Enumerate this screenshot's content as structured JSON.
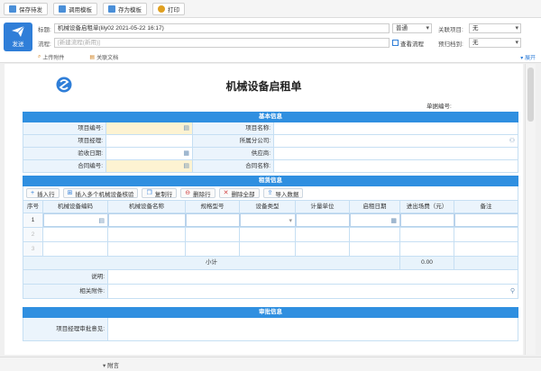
{
  "toolbar": {
    "buttons": [
      {
        "label": "保存待发",
        "color": "#4a8fd8"
      },
      {
        "label": "调用模板",
        "color": "#4a8fd8"
      },
      {
        "label": "存为模板",
        "color": "#4a8fd8"
      },
      {
        "label": "打印",
        "color": "#e0a020"
      }
    ]
  },
  "header": {
    "send_label": "发送",
    "title_label": "标题:",
    "title_value": "机械设备启租单(lily02 2021-05-22 16:17)",
    "priority": "普通",
    "related_project_label": "关联项目:",
    "related_project_value": "无",
    "flow_label": "流程:",
    "flow_placeholder": "[新建流程(新用)]",
    "view_flow": "查看流程",
    "deadline_label": "预归档到:",
    "deadline_value": "无",
    "upload_attachment": "上传附件",
    "related_doc": "关联文档",
    "expand": "展开"
  },
  "form": {
    "title": "机械设备启租单",
    "doc_no_label": "单据编号:",
    "basic_section": "基本信息",
    "basic_fields": {
      "project_code": "项目编号:",
      "project_name": "项目名称:",
      "project_manager": "项目经理:",
      "branch": "所属分公司:",
      "acceptance_date": "验收日期:",
      "supplier": "供应商:",
      "contract_no": "合同编号:",
      "contract_name": "合同名称:"
    },
    "detail_section": "租赁信息",
    "detail_buttons": {
      "insert_row": "插入行",
      "insert_multi": "插入多个机械设备核验",
      "copy_row": "复制行",
      "delete_row": "删除行",
      "delete_all": "删除全部",
      "import": "导入数据"
    },
    "columns": [
      "序号",
      "机械设备编码",
      "机械设备名称",
      "规格型号",
      "设备类型",
      "计量单位",
      "启租日期",
      "进出场费（元）",
      "备注"
    ],
    "rows": [
      "1",
      "2",
      "3"
    ],
    "subtotal_label": "小计",
    "subtotal_value": "0.00",
    "note_label": "说明:",
    "attachment_label": "相关附件:",
    "approval_section": "审批信息",
    "pm_opinion_label": "项目经理审批意见:"
  },
  "footer": {
    "label": "附言"
  }
}
